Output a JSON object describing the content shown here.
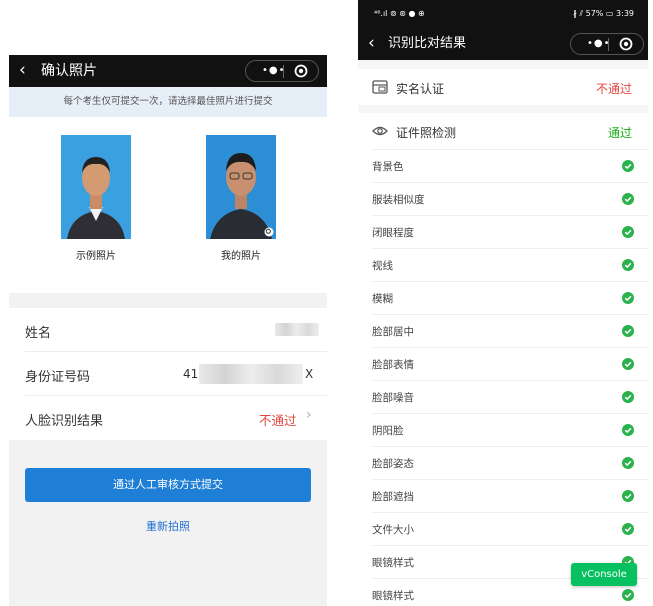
{
  "left": {
    "title": "确认照片",
    "back_icon": "chevron-left-icon",
    "notice": "每个考生仅可提交一次，请选择最佳照片进行提交",
    "photos": [
      {
        "caption": "示例照片",
        "caption_color": "#444444"
      },
      {
        "caption": "我的照片",
        "caption_color": "#1f6fd1"
      }
    ],
    "rows": {
      "name_label": "姓名",
      "id_label": "身份证号码",
      "id_prefix": "41",
      "id_suffix": "X",
      "face_label": "人脸识别结果",
      "face_value": "不通过",
      "face_arrow": "›"
    },
    "submit_button": "通过人工审核方式提交",
    "retake_link": "重新拍照"
  },
  "right": {
    "status_left": "⁴⁶.ıl ⊚ ⊛ ● ⊕",
    "status_right": "∦ ⫽ 57% ▭ 3:39",
    "title": "识别比对结果",
    "sections": [
      {
        "label": "实名认证",
        "status": "不通过",
        "status_color": "#e0473d",
        "icon": "id-card-icon"
      },
      {
        "label": "证件照检测",
        "status": "通过",
        "status_color": "#1aad19",
        "icon": "eye-icon"
      }
    ],
    "items": [
      "背景色",
      "服装相似度",
      "闭眼程度",
      "视线",
      "模糊",
      "脸部居中",
      "脸部表情",
      "脸部噪音",
      "阴阳脸",
      "脸部姿态",
      "脸部遮挡",
      "文件大小",
      "眼镜样式",
      "眼镜样式"
    ]
  },
  "vconsole": "vConsole",
  "colors": {
    "accent": "#1f7fd6",
    "fail": "#e0473d",
    "pass": "#1aad19",
    "check": "#2bb24c"
  }
}
